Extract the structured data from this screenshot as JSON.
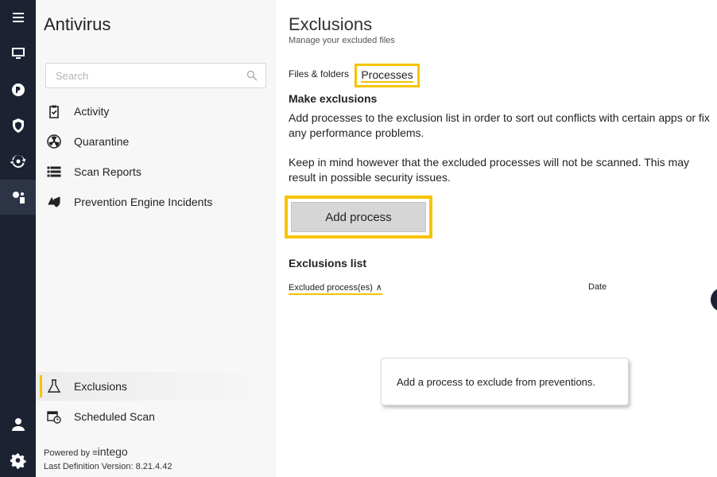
{
  "rail": {
    "icons": [
      "menu-icon",
      "monitor-icon",
      "chat-icon",
      "shield-icon",
      "sync-icon",
      "settings-apps-icon",
      "user-icon",
      "gear-icon"
    ]
  },
  "sidebar": {
    "title": "Antivirus",
    "search_placeholder": "Search",
    "items": [
      {
        "label": "Activity",
        "icon": "clipboard-check-icon"
      },
      {
        "label": "Quarantine",
        "icon": "radiation-icon"
      },
      {
        "label": "Scan Reports",
        "icon": "list-icon"
      },
      {
        "label": "Prevention Engine Incidents",
        "icon": "incident-icon"
      }
    ],
    "bottom_items": [
      {
        "label": "Exclusions",
        "icon": "flask-icon",
        "active": true
      },
      {
        "label": "Scheduled Scan",
        "icon": "calendar-clock-icon"
      }
    ],
    "powered_by": "Powered by",
    "brand": "intego",
    "definition": "Last Definition Version:  8.21.4.42"
  },
  "main": {
    "title": "Exclusions",
    "subtitle": "Manage your excluded files",
    "tabs": [
      {
        "label": "Files & folders",
        "active": false
      },
      {
        "label": "Processes",
        "active": true
      }
    ],
    "make_heading": "Make exclusions",
    "para1": "Add processes to the exclusion list in order to sort out conflicts with certain apps or fix any performance problems.",
    "para2": "Keep in mind however that the excluded processes will not be scanned. This may result in possible security issues.",
    "add_button": "Add process",
    "list_heading": "Exclusions list",
    "columns": {
      "process": "Excluded process(es)",
      "date": "Date"
    },
    "empty_message": "Add a process to exclude from preventions."
  },
  "colors": {
    "accent": "#f5c400",
    "rail": "#1c2232"
  }
}
